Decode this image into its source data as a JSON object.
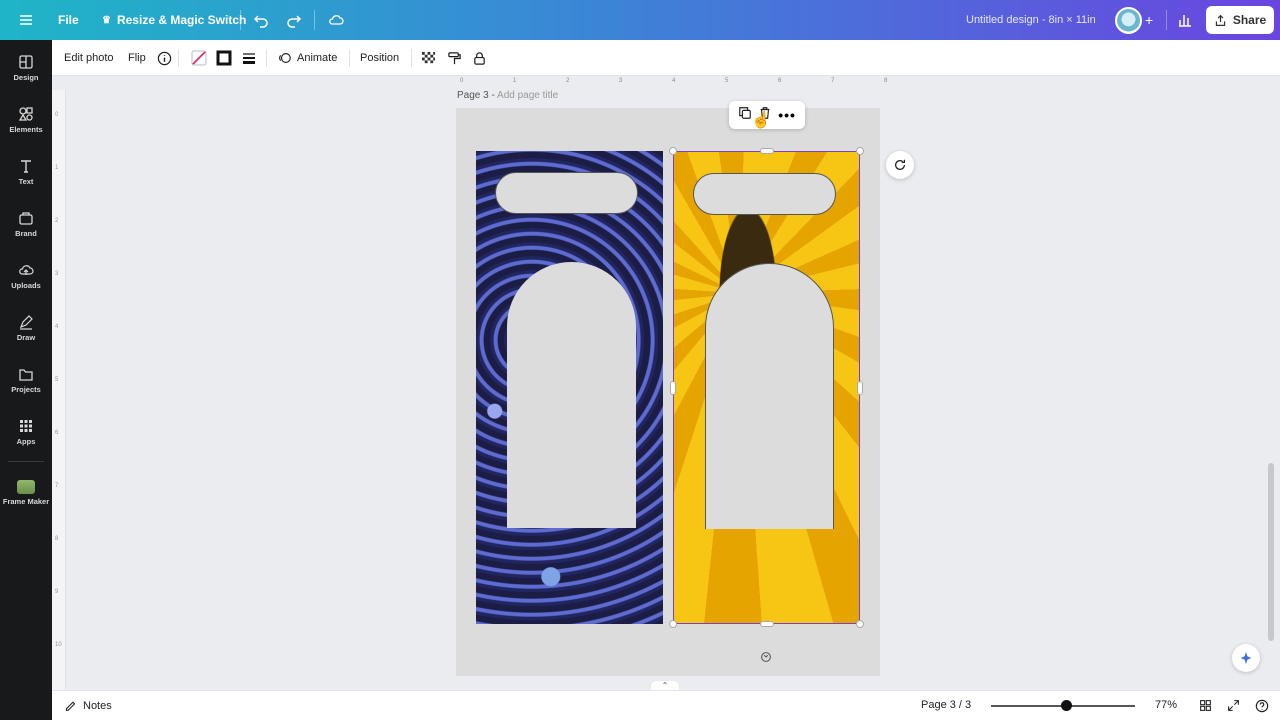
{
  "topbar": {
    "file_label": "File",
    "resize_label": "Resize & Magic Switch",
    "doc_title": "Untitled design - 8in × 11in",
    "share_label": "Share"
  },
  "sidebar": {
    "items": [
      {
        "label": "Design",
        "icon": "design-icon"
      },
      {
        "label": "Elements",
        "icon": "elements-icon"
      },
      {
        "label": "Text",
        "icon": "text-icon"
      },
      {
        "label": "Brand",
        "icon": "brand-icon"
      },
      {
        "label": "Uploads",
        "icon": "uploads-icon"
      },
      {
        "label": "Draw",
        "icon": "draw-icon"
      },
      {
        "label": "Projects",
        "icon": "projects-icon"
      },
      {
        "label": "Apps",
        "icon": "apps-icon"
      },
      {
        "label": "Frame Maker",
        "icon": "frame-maker-icon"
      }
    ]
  },
  "toolbar": {
    "edit_photo": "Edit photo",
    "flip": "Flip",
    "animate": "Animate",
    "position": "Position"
  },
  "canvas": {
    "page_label": "Page 3 -",
    "page_title_placeholder": "Add page title",
    "ruler_top": [
      "0",
      "1",
      "2",
      "3",
      "4",
      "5",
      "6",
      "7",
      "8"
    ],
    "ruler_left": [
      "0",
      "1",
      "2",
      "3",
      "4",
      "5",
      "6",
      "7",
      "8",
      "9",
      "10"
    ]
  },
  "bottombar": {
    "notes_label": "Notes",
    "page_indicator": "Page 3 / 3",
    "zoom": "77%",
    "zoom_fraction": 0.49
  },
  "colors": {
    "selection": "#7a3fd1",
    "topbar_start": "#1fb5c7",
    "topbar_end": "#6a45e0"
  }
}
